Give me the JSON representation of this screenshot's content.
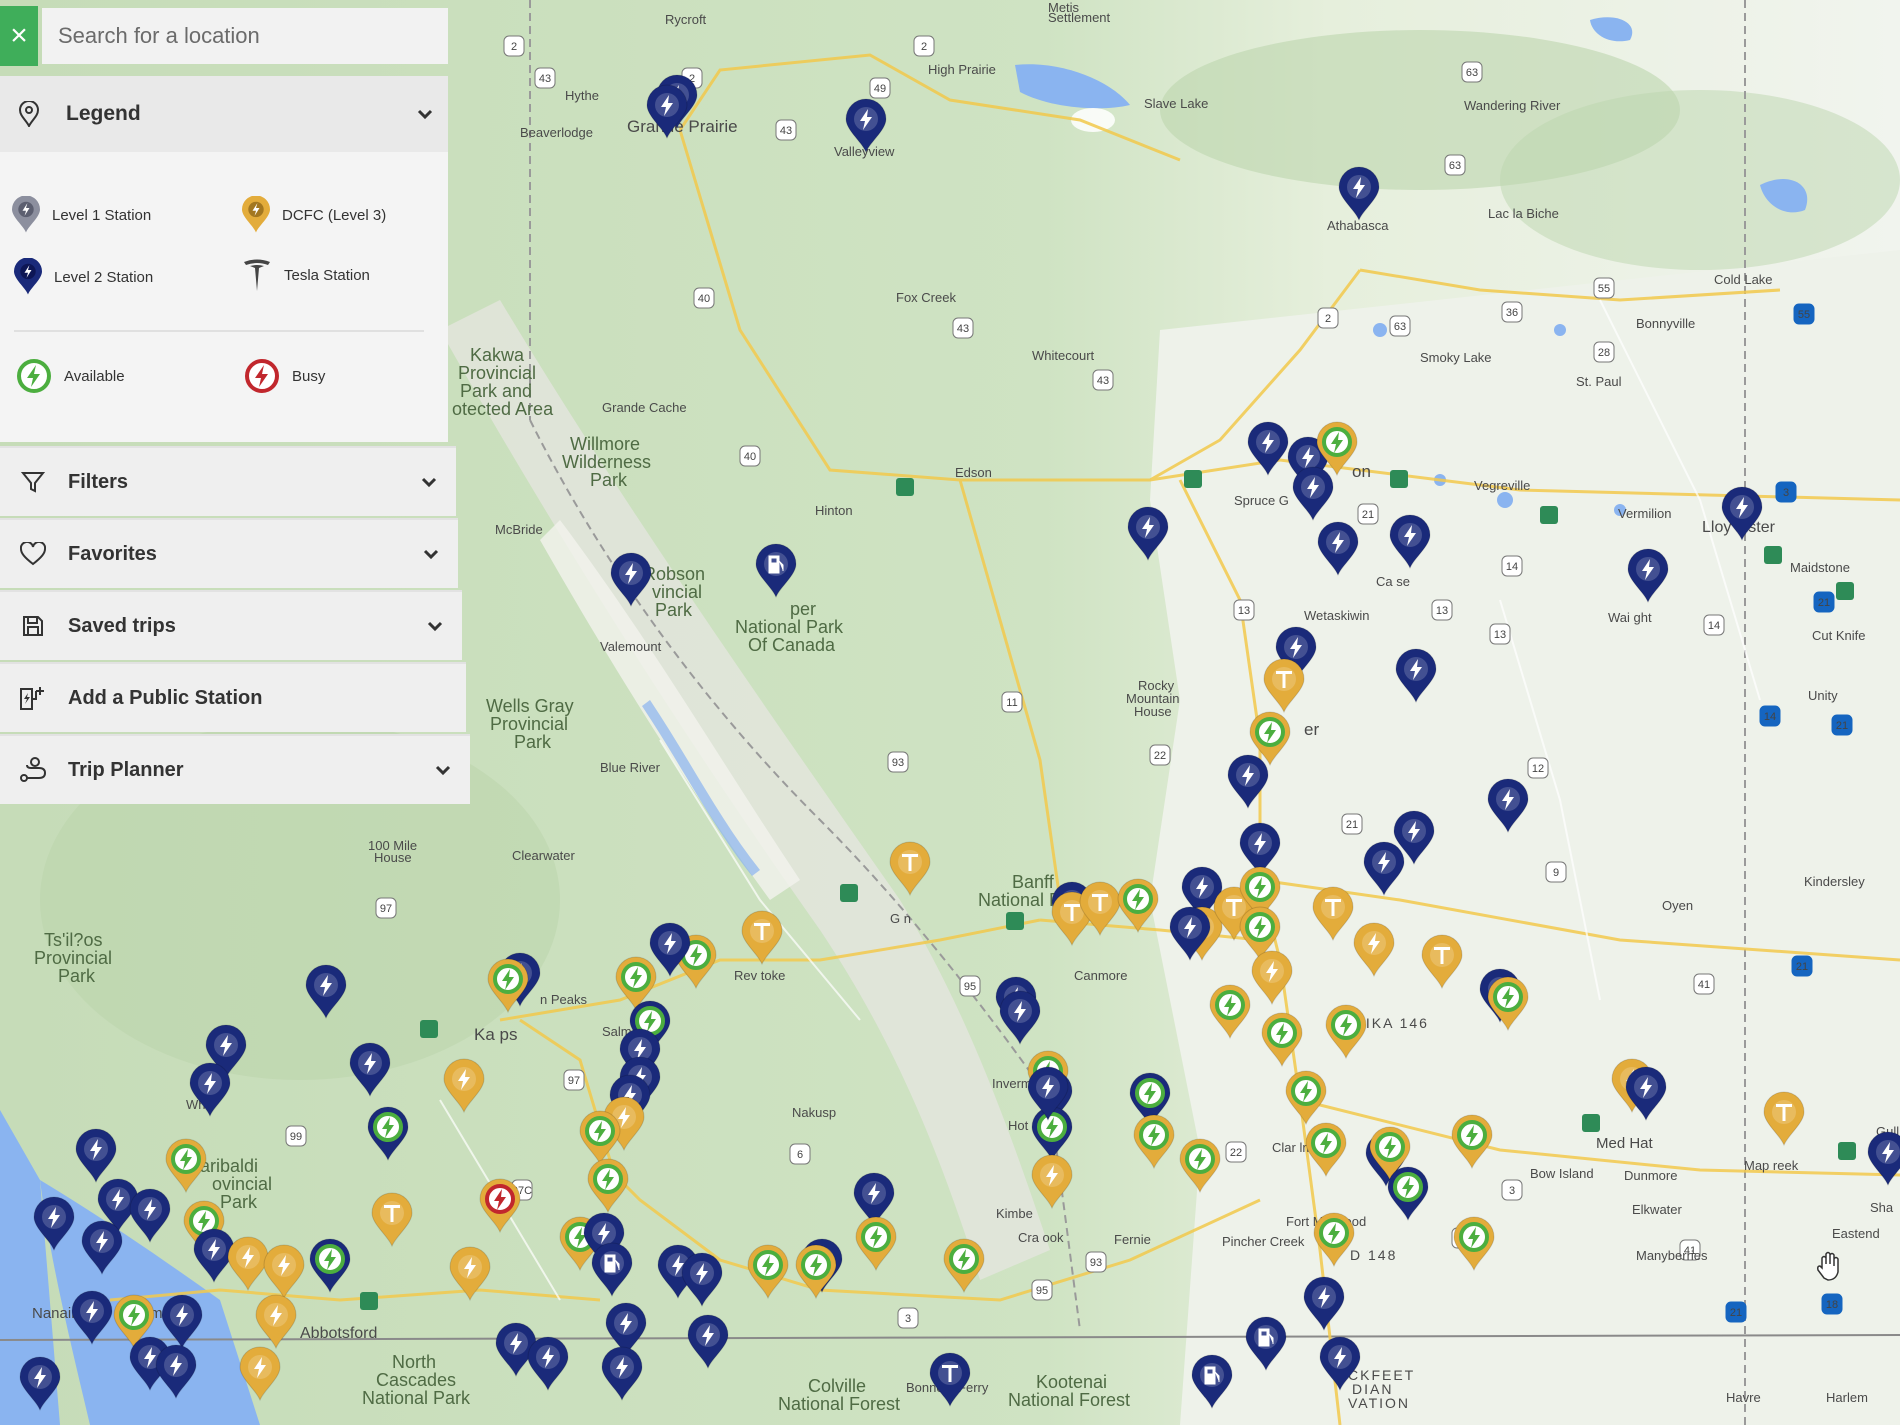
{
  "search": {
    "placeholder": "Search for a location",
    "close_glyph": "×"
  },
  "legend": {
    "title": "Legend",
    "items": [
      {
        "label": "Level 1 Station",
        "color": "#8c8f9e"
      },
      {
        "label": "DCFC (Level 3)",
        "color": "#e3ac3b"
      },
      {
        "label": "Level 2 Station",
        "color": "#1a2a7a"
      },
      {
        "label": "Tesla Station",
        "color": "#444444"
      },
      {
        "label": "Available",
        "color": "#4cae3f"
      },
      {
        "label": "Busy",
        "color": "#c1272d"
      }
    ]
  },
  "menu": [
    {
      "label": "Filters",
      "icon": "funnel-icon",
      "has_chevron": true
    },
    {
      "label": "Favorites",
      "icon": "heart-icon",
      "has_chevron": true
    },
    {
      "label": "Saved trips",
      "icon": "floppy-disk-icon",
      "has_chevron": true
    },
    {
      "label": "Add a Public Station",
      "icon": "add-charger-icon",
      "has_chevron": false
    },
    {
      "label": "Trip Planner",
      "icon": "route-icon",
      "has_chevron": true
    }
  ],
  "colors": {
    "level2": "#1a2a7a",
    "dcfc": "#e3ac3b",
    "available": "#4cae3f",
    "busy": "#c1272d",
    "accent": "#3fae5a"
  },
  "map_labels": {
    "rycroft": "Rycroft",
    "hythe": "Hythe",
    "beaverlodge": "Beaverlodge",
    "grande_prairie": "Grande Prairie",
    "valleyview": "Valleyview",
    "high_prairie": "High Prairie",
    "slave_lake": "Slave Lake",
    "wandering_river": "Wandering River",
    "athabasca": "Athabasca",
    "lac_la_biche": "Lac la Biche",
    "cold_lake": "Cold Lake",
    "bonnyville": "Bonnyville",
    "smoky_lake": "Smoky Lake",
    "st_paul": "St. Paul",
    "fox_creek": "Fox Creek",
    "whitecourt": "Whitecourt",
    "grande_cache": "Grande Cache",
    "kakwa_1": "Kakwa",
    "kakwa_2": "Provincial",
    "kakwa_3": "Park and",
    "kakwa_4": "otected Area",
    "willmore_1": "Willmore",
    "willmore_2": "Wilderness",
    "willmore_3": "Park",
    "edson": "Edson",
    "hinton": "Hinton",
    "mcbride": "McBride",
    "mt_robson_1": "Mt Robson",
    "mt_robson_2": "vincial",
    "mt_robson_3": "Park",
    "jasper_1": "per",
    "jasper_2": "National Park",
    "jasper_3": "Of Canada",
    "valemount": "Valemount",
    "spruce_grove": "Spruce G",
    "edmonton": "on",
    "vegreville": "Vegreville",
    "vermilion": "Vermilion",
    "lloydminster": "Lloy      inster",
    "maidstone": "Maidstone",
    "wetaskiwin": "Wetaskiwin",
    "camrose": "Ca      se",
    "wainwright": "Wai     ght",
    "cut_knife": "Cut Knife",
    "unity": "Unity",
    "rocky_1": "Rocky",
    "rocky_2": "Mountain",
    "rocky_3": "House",
    "red_deer": "er",
    "wells_gray_1": "Wells Gray",
    "wells_gray_2": "Provincial",
    "wells_gray_3": "Park",
    "blue_river": "Blue River",
    "clearwater": "Clearwater",
    "mile_100_1": "100 Mile",
    "mile_100_2": "House",
    "banff_1": "Banff",
    "banff_2": "National P",
    "canmore": "Canmore",
    "golden": "G    n",
    "revelstoke": "Rev      toke",
    "kamloops": "Ka        ps",
    "sun_peaks": "n Peaks",
    "salmon_arm": "Salm",
    "tsilhqotin_1": "Ts'il?os",
    "tsilhqotin_2": "Provincial",
    "tsilhqotin_3": "Park",
    "garibaldi_1": "aribaldi",
    "garibaldi_2": "ovincial",
    "garibaldi_3": "Park",
    "whistler": "Wh",
    "nakusp": "Nakusp",
    "invermere": "Inverm",
    "hot_springs": "Hot S   ngs",
    "kimberley": "Kimbe",
    "cranbrook": "Cra       ook",
    "fernie": "Fernie",
    "siksika": "SIKSIKA 146",
    "claresholm": "Clar     lm",
    "fort_macleod": "Fort MacLeod",
    "pincher_creek": "Pincher Creek",
    "blood": "D 148",
    "medicine_hat": "Med          Hat",
    "bow_island": "Bow Island",
    "dunmore": "Dunmore",
    "elkwater": "Elkwater",
    "manyberries": "Manyberries",
    "maple_creek": "Map       reek",
    "eastend": "Eastend",
    "oyen": "Oyen",
    "kindersley": "Kindersley",
    "nanaimo": "Nanaimo",
    "richmond": "Richmond",
    "abbotsford": "Abbotsford",
    "north_cascades_1": "North",
    "north_cascades_2": "Cascades",
    "north_cascades_3": "National Park",
    "colville_1": "Colville",
    "colville_2": "National Forest",
    "kootenai_1": "Kootenai",
    "kootenai_2": "National Forest",
    "bonners_ferry": "Bonners Ferry",
    "blackfeet_1": "CKFEET",
    "blackfeet_2": "DIAN",
    "blackfeet_3": "VATION",
    "havre": "Havre",
    "harlem": "Harlem",
    "metis": "Metis",
    "settlement": "Settlement",
    "gull": "Gull",
    "sha": "Sha"
  }
}
